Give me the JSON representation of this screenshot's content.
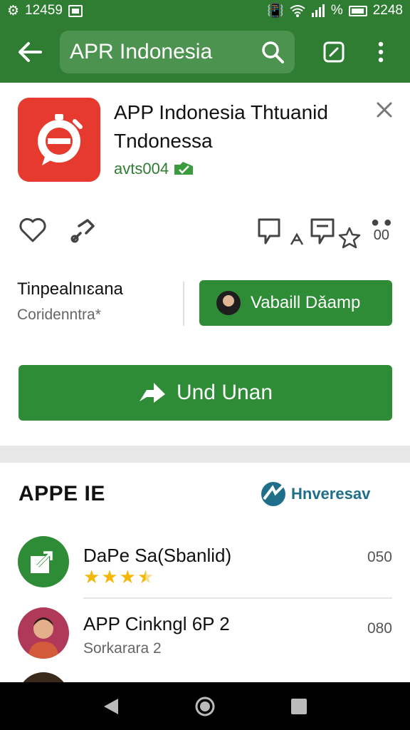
{
  "status": {
    "time": "12459",
    "right_text": "2248",
    "percent": "%"
  },
  "appbar": {
    "search_text": "APR Indonesia"
  },
  "app": {
    "title": "APP Indonesia Thtuanid Tndonessa",
    "developer": "avts004",
    "icon_color": "#e63a2e"
  },
  "info": {
    "title": "Tinpealnıɛana",
    "subtitle": "Coridenntra*",
    "contact_label": "Vabaill Dǎamp"
  },
  "main_button": {
    "label": "Und Unan"
  },
  "section": {
    "title": "APPE IE",
    "link_label": "Hnveresav"
  },
  "list": [
    {
      "title": "DaPe Sa(Sbanlid)",
      "meta": "050",
      "rating": 3.5
    },
    {
      "title": "APP Cinkngl 6P 2",
      "subtitle": "Sorkarara 2",
      "meta": "080"
    }
  ],
  "colors": {
    "primary": "#2e7d32",
    "button": "#2e8b36",
    "accent_star": "#f2b707"
  }
}
